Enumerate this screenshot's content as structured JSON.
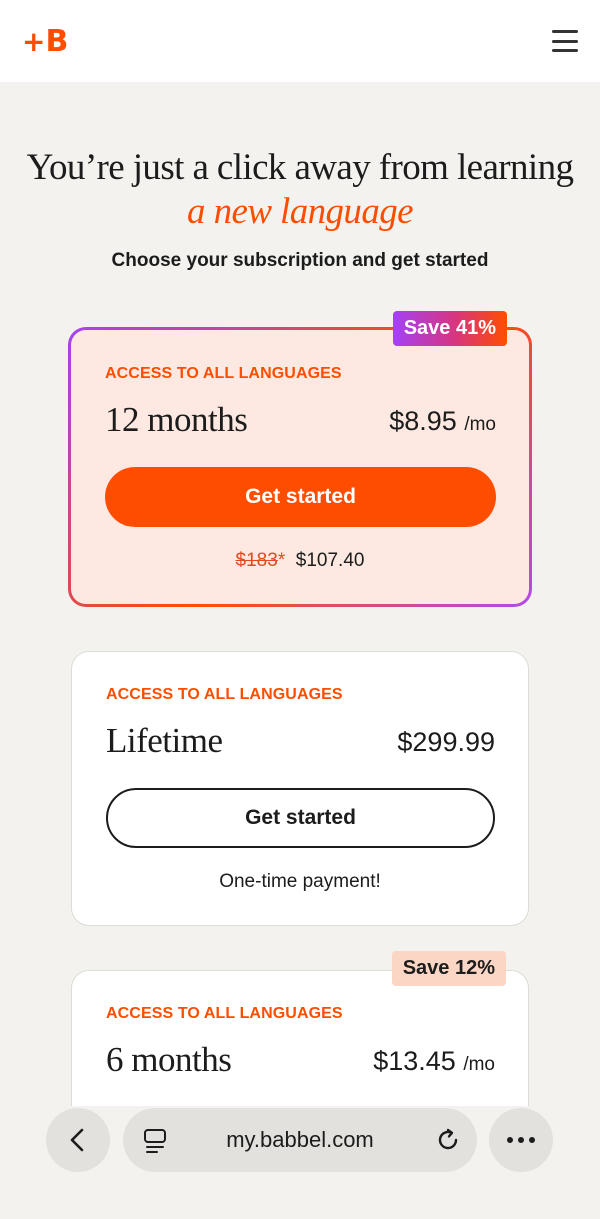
{
  "header": {
    "logo_text": "+B",
    "logo_plus": "+",
    "logo_letter": "B",
    "brand_color": "#ff4d00"
  },
  "hero": {
    "title_line1": "You’re just a click away from learning",
    "title_accent": "a new language",
    "subtitle": "Choose your subscription and get started"
  },
  "plans": [
    {
      "badge": "Save 41%",
      "access": "ACCESS TO ALL LANGUAGES",
      "name": "12 months",
      "price": "$8.95",
      "per": "/mo",
      "button": "Get started",
      "old_price": "$183",
      "old_price_marker": "*",
      "total": "$107.40"
    },
    {
      "access": "ACCESS TO ALL LANGUAGES",
      "name": "Lifetime",
      "price": "$299.99",
      "button": "Get started",
      "note": "One-time payment!"
    },
    {
      "badge": "Save 12%",
      "access": "ACCESS TO ALL LANGUAGES",
      "name": "6 months",
      "price": "$13.45",
      "per": "/mo"
    }
  ],
  "browser": {
    "url": "my.babbel.com",
    "icons": [
      "back-icon",
      "tabs-icon",
      "reload-icon",
      "more-icon"
    ]
  }
}
